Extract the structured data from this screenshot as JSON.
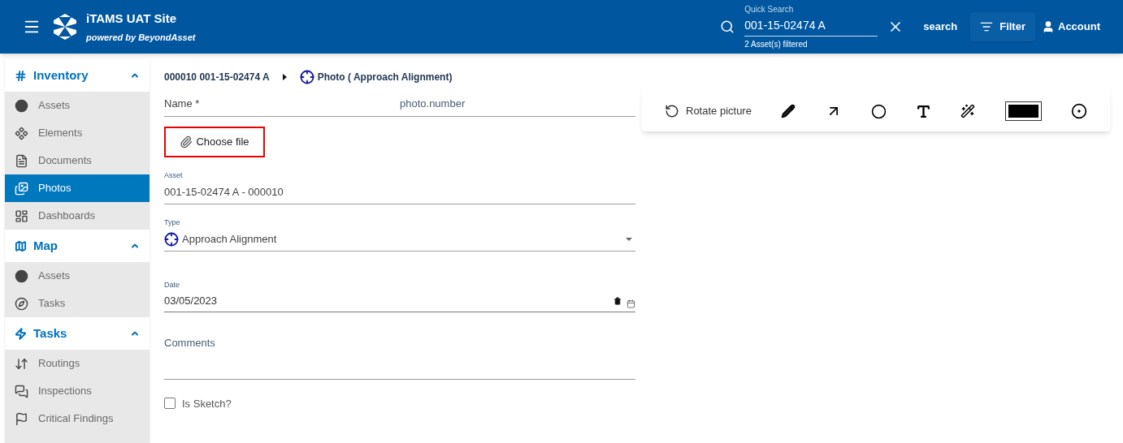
{
  "header": {
    "title": "iTAMS UAT Site",
    "subtitle": "powered by BeyondAsset",
    "quick_search": {
      "label": "Quick Search",
      "value": "001-15-02474 A",
      "hint": "2 Asset(s) filtered"
    },
    "search_button": "search",
    "filter_button": "Filter",
    "account_button": "Account"
  },
  "sidebar": {
    "sections": [
      {
        "title": "Inventory",
        "expanded": true,
        "items": [
          {
            "label": "Assets",
            "selected": false
          },
          {
            "label": "Elements",
            "selected": false
          },
          {
            "label": "Documents",
            "selected": false
          },
          {
            "label": "Photos",
            "selected": true
          },
          {
            "label": "Dashboards",
            "selected": false
          }
        ]
      },
      {
        "title": "Map",
        "expanded": true,
        "items": [
          {
            "label": "Assets",
            "selected": false
          },
          {
            "label": "Tasks",
            "selected": false
          }
        ]
      },
      {
        "title": "Tasks",
        "expanded": true,
        "items": [
          {
            "label": "Routings",
            "selected": false
          },
          {
            "label": "Inspections",
            "selected": false
          },
          {
            "label": "Critical Findings",
            "selected": false
          }
        ]
      }
    ]
  },
  "breadcrumb": [
    "000010 001-15-02474 A",
    "Photo ( Approach Alignment)"
  ],
  "form": {
    "name": {
      "label": "Name *",
      "value": "photo.number"
    },
    "choose_file": "Choose file",
    "asset": {
      "label": "Asset",
      "value": "001-15-02474 A - 000010"
    },
    "type": {
      "label": "Type",
      "value": "Approach Alignment"
    },
    "date": {
      "label": "Date",
      "value": "03/05/2023"
    },
    "comments": {
      "label": "Comments"
    },
    "is_sketch": {
      "label": "Is Sketch?",
      "checked": false
    }
  },
  "toolbar": {
    "rotate_button": "Rotate picture"
  }
}
